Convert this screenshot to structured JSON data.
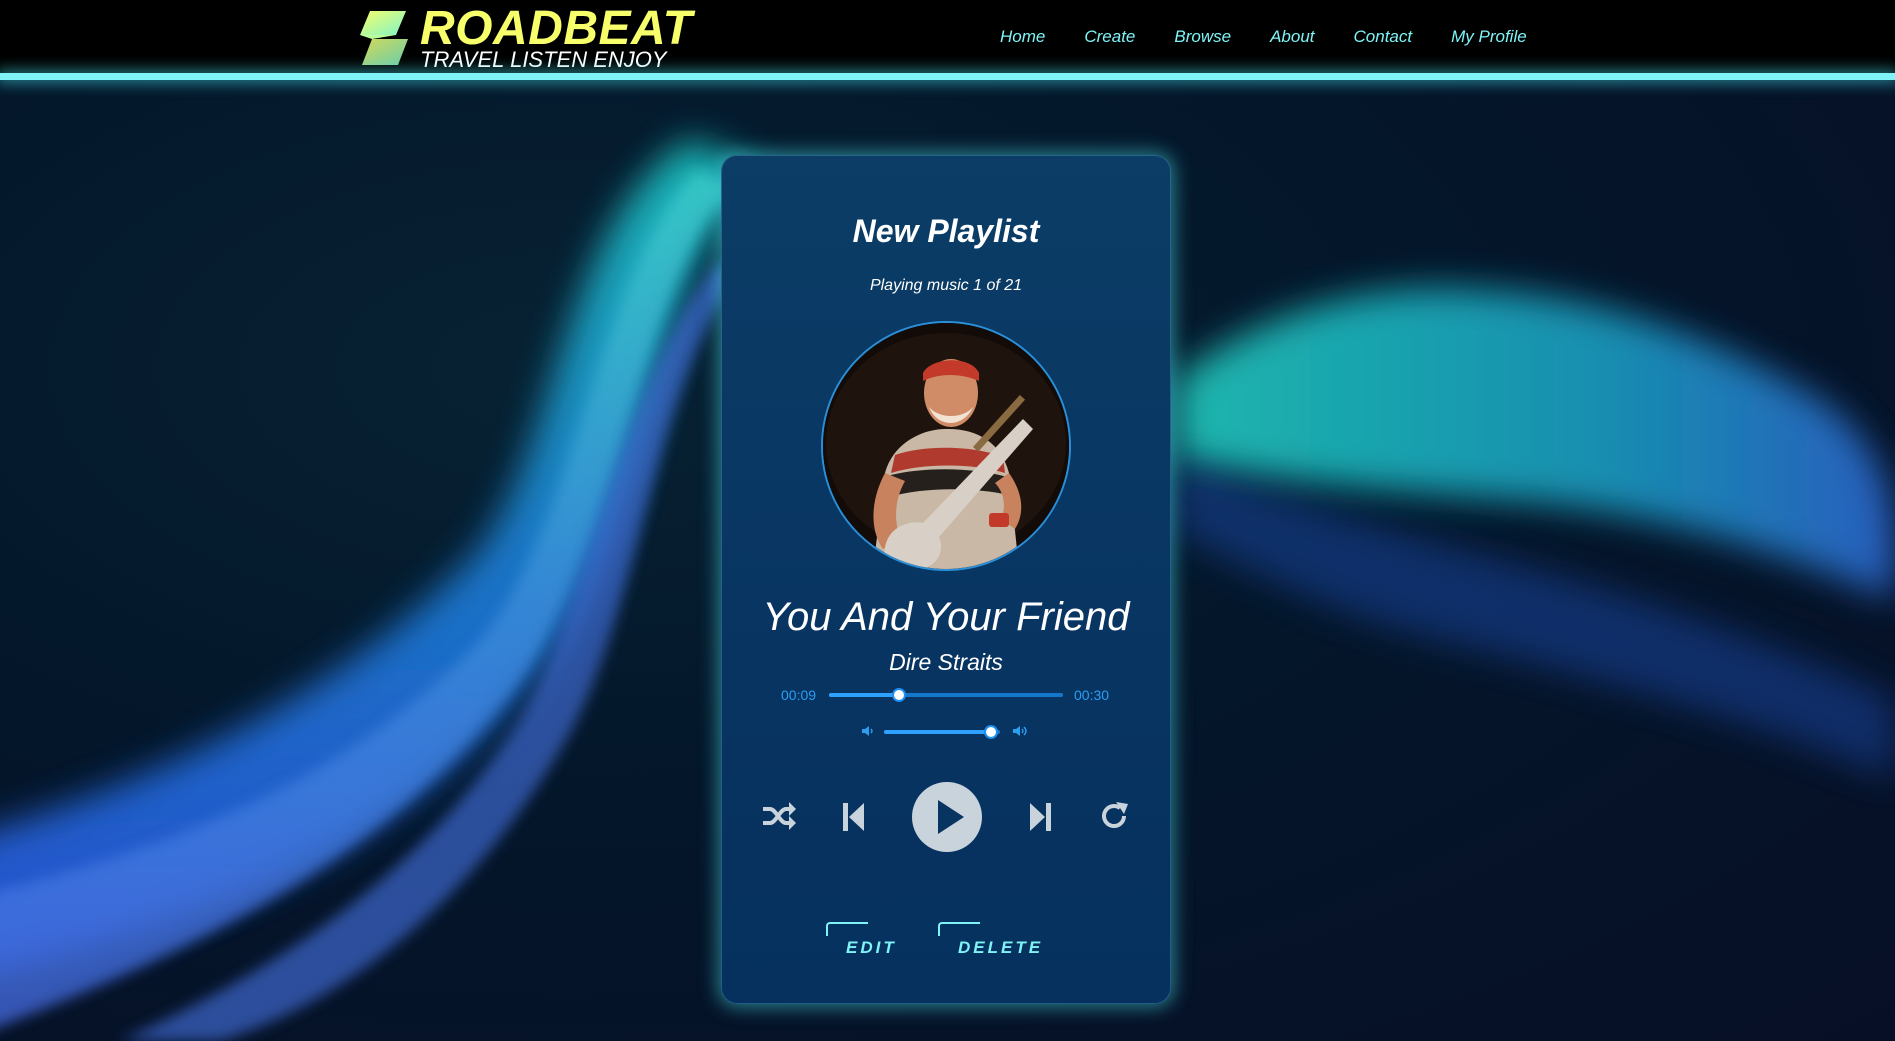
{
  "brand": {
    "name": "ROADBEAT",
    "tagline": "TRAVEL LISTEN ENJOY"
  },
  "nav": {
    "items": [
      "Home",
      "Create",
      "Browse",
      "About",
      "Contact",
      "My Profile"
    ]
  },
  "player": {
    "playlist_title": "New Playlist",
    "status": "Playing music 1 of 21",
    "track_title": "You And Your Friend",
    "artist": "Dire Straits",
    "current_time": "00:09",
    "duration": "00:30",
    "progress_fraction": 0.3,
    "volume_fraction": 0.92,
    "actions": {
      "edit": "EDIT",
      "delete": "DELETE"
    }
  },
  "icons": {
    "logo": "roadbeat-logo-icon",
    "shuffle": "shuffle-icon",
    "previous": "skip-back-icon",
    "play": "play-icon",
    "next": "skip-forward-icon",
    "repeat": "repeat-icon",
    "volume_low": "volume-low-icon",
    "volume_high": "volume-high-icon"
  },
  "colors": {
    "accent": "#7ff3f6",
    "brand_yellow": "#f7ff6a",
    "card_bg": "#083462",
    "slider_blue": "#2fa2ff"
  }
}
